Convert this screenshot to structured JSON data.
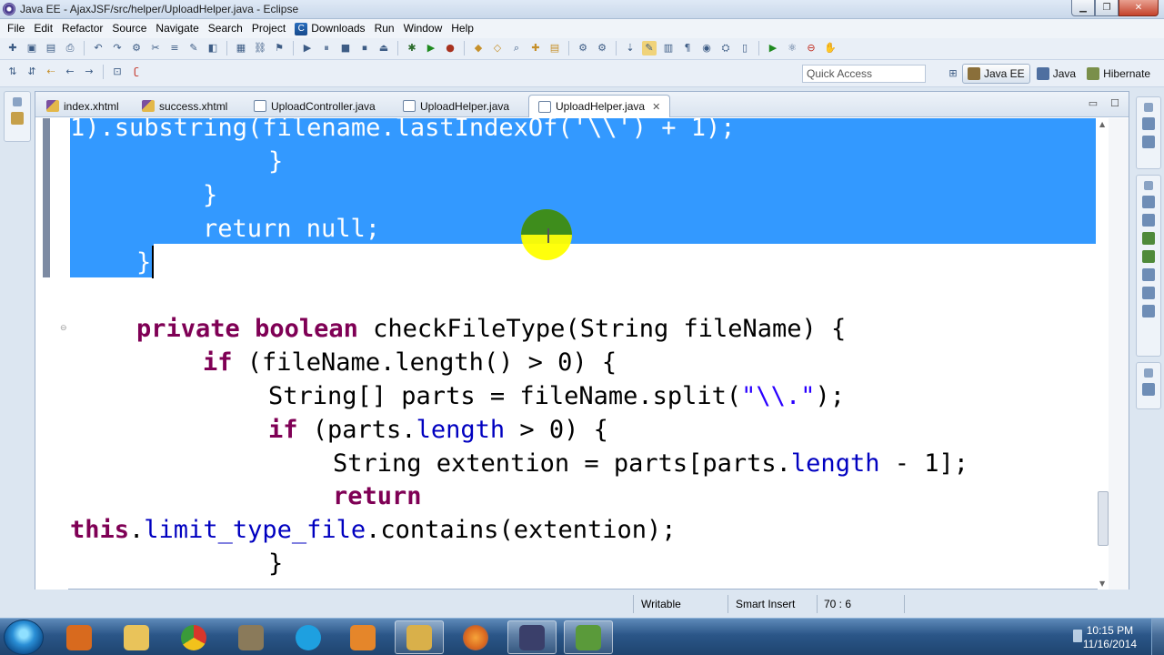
{
  "window": {
    "title": "Java EE - AjaxJSF/src/helper/UploadHelper.java - Eclipse",
    "buttons": {
      "minimize": "▁",
      "maximize": "❐",
      "close": "✕"
    }
  },
  "menu": {
    "items": [
      "File",
      "Edit",
      "Refactor",
      "Source",
      "Navigate",
      "Search",
      "Project",
      "Downloads",
      "Run",
      "Window",
      "Help"
    ]
  },
  "toolbar": {
    "quick_access_placeholder": "Quick Access"
  },
  "perspectives": [
    {
      "label": "Java EE",
      "active": true,
      "color": "#8a6f3a"
    },
    {
      "label": "Java",
      "active": false,
      "color": "#4f6fa0"
    },
    {
      "label": "Hibernate",
      "active": false,
      "color": "#7a8f4a"
    }
  ],
  "editor": {
    "tabs": [
      {
        "label": "index.xhtml",
        "type": "xhtml",
        "active": false
      },
      {
        "label": "success.xhtml",
        "type": "xhtml",
        "active": false
      },
      {
        "label": "UploadController.java",
        "type": "java",
        "active": false
      },
      {
        "label": "UploadHelper.java",
        "type": "java",
        "active": false
      },
      {
        "label": "UploadHelper.java",
        "type": "java",
        "active": true
      }
    ],
    "tab_close": "✕",
    "view_controls": {
      "minimize": "▭",
      "maximize": "☐"
    },
    "code_lines": {
      "l1": "1).substring(filename.lastIndexOf('\\\\') + 1);",
      "l2": "}",
      "l3": "}",
      "l4": "return null;",
      "l5": "}",
      "l6_kw1": "private",
      "l6_kw2": "boolean",
      "l6_rest": " checkFileType(String fileName) {",
      "l7_kw": "if",
      "l7_rest": " (fileName.length() > 0) {",
      "l8_a": "String[] parts = fileName.split(",
      "l8_str": "\"\\\\.\"",
      "l8_b": ");",
      "l9_kw": "if",
      "l9_a": " (parts.",
      "l9_fld": "length",
      "l9_b": " > 0) {",
      "l10_a": "String extention = parts[parts.",
      "l10_fld": "length",
      "l10_b": " - 1];",
      "l11_kw": "return",
      "l12_kw": "this",
      "l12_a": ".",
      "l12_fld": "limit_type_file",
      "l12_b": ".contains(extention);",
      "l13": "}"
    },
    "selection_color": "#3399ff"
  },
  "status": {
    "writable": "Writable",
    "insert_mode": "Smart Insert",
    "position": "70 : 6"
  },
  "taskbar": {
    "apps": [
      {
        "name": "media-player",
        "color": "#d86a1e",
        "active": false
      },
      {
        "name": "windows-explorer",
        "color": "#e9c35a",
        "active": false
      },
      {
        "name": "chrome",
        "color": "#3a9a3a",
        "active": false
      },
      {
        "name": "gimp",
        "color": "#8a7a5a",
        "active": false
      },
      {
        "name": "skype",
        "color": "#1ea0e0",
        "active": false
      },
      {
        "name": "ms-office",
        "color": "#e5862a",
        "active": false
      },
      {
        "name": "file-explorer",
        "color": "#d9b04a",
        "active": false
      },
      {
        "name": "firefox",
        "color": "#d9661e",
        "active": false
      },
      {
        "name": "eclipse-java-ee",
        "color": "#3a3f6a",
        "active": true
      },
      {
        "name": "notepad-plus",
        "color": "#5a9a3a",
        "active": false
      }
    ],
    "clock_time": "10:15 PM",
    "clock_date": "11/16/2014"
  }
}
